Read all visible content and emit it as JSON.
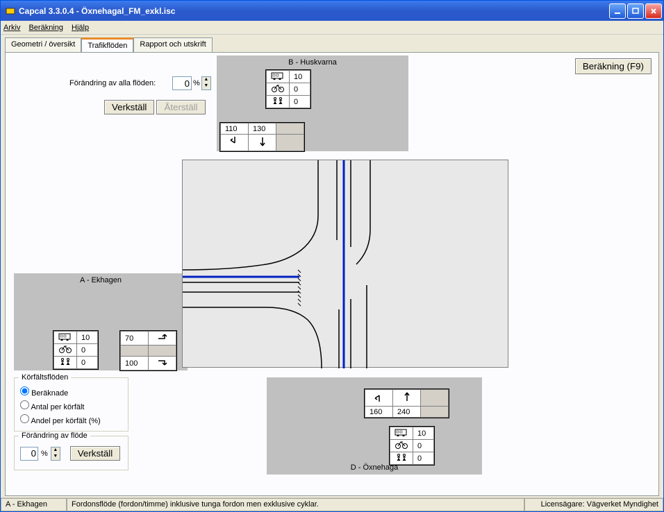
{
  "title": "Capcal 3.3.0.4 - Öxnehagal_FM_exkl.isc",
  "menu": {
    "arkiv": "Arkiv",
    "berakning": "Beräkning",
    "hjalp": "Hjälp"
  },
  "tabs": {
    "geometri": "Geometri / översikt",
    "trafik": "Trafikflöden",
    "rapport": "Rapport och utskrift"
  },
  "calc_btn": "Beräkning (F9)",
  "flow_change": {
    "label": "Förändring av alla flöden:",
    "value": "0",
    "pct": "%",
    "verkstall": "Verkställ",
    "aterstall": "Återställ"
  },
  "approach_b": {
    "title": "B - Huskvarna",
    "bus": "10",
    "bike": "0",
    "ped": "0",
    "flow1": "110",
    "flow2": "130"
  },
  "approach_a": {
    "title": "A - Ekhagen",
    "bus": "10",
    "bike": "0",
    "ped": "0",
    "flow1": "70",
    "flow2": "100"
  },
  "approach_d": {
    "title": "D - Öxnehaga",
    "bus": "10",
    "bike": "0",
    "ped": "0",
    "flow1": "160",
    "flow2": "240"
  },
  "korfalt": {
    "title": "Körfältsflöden",
    "r1": "Beräknade",
    "r2": "Antal per körfält",
    "r3": "Andel per körfält (%)"
  },
  "forandring": {
    "title": "Förändring av flöde",
    "value": "0",
    "pct": "%",
    "verkstall": "Verkställ"
  },
  "status": {
    "s1": "A - Ekhagen",
    "s2": "Fordonsflöde (fordon/timme) inklusive tunga fordon men exklusive cyklar.",
    "s3": "Licensägare: Vägverket Myndighet"
  },
  "icons": {
    "bus": "bus",
    "bike": "bike",
    "ped": "ped"
  }
}
